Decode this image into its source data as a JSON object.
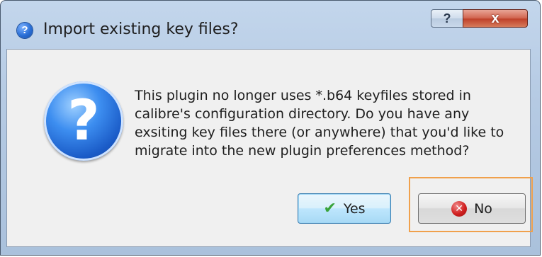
{
  "window": {
    "title": "Import existing key files?",
    "help_glyph": "?",
    "close_glyph": "x"
  },
  "dialog": {
    "icon": "question-icon",
    "icon_glyph": "?",
    "message": "This plugin no longer uses *.b64 keyfiles stored in calibre's configuration directory. Do you have any exsiting key files there (or anywhere) that you'd like to migrate into the new plugin preferences method?"
  },
  "buttons": {
    "yes_label": "Yes",
    "no_label": "No",
    "yes_icon": "check-icon",
    "no_icon": "error-x-icon"
  },
  "colors": {
    "highlight": "#f0a04b",
    "accent": "#2a6fd6"
  }
}
